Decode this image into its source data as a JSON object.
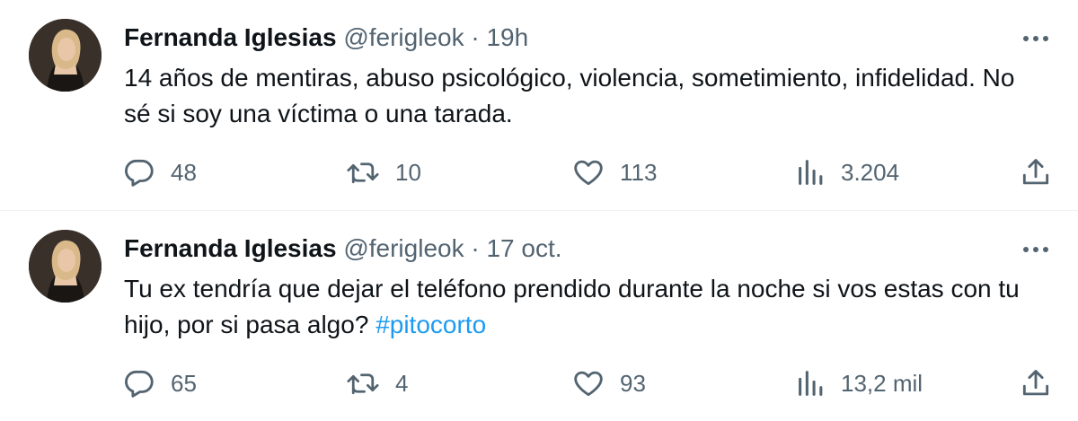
{
  "tweets": [
    {
      "author_name": "Fernanda Iglesias",
      "handle": "@ferigleok",
      "separator": "·",
      "time": "19h",
      "text": "14 años de mentiras, abuso psicológico, violencia, sometimiento, infidelidad. No sé si soy una víctima o una tarada.",
      "hashtag": "",
      "replies": "48",
      "retweets": "10",
      "likes": "113",
      "views": "3.204"
    },
    {
      "author_name": "Fernanda Iglesias",
      "handle": "@ferigleok",
      "separator": "·",
      "time": "17 oct.",
      "text": "Tu ex tendría que dejar el teléfono prendido durante la noche si vos estas con tu hijo, por si pasa algo?",
      "hashtag": "#pitocorto",
      "replies": "65",
      "retweets": "4",
      "likes": "93",
      "views": "13,2 mil"
    }
  ],
  "icons": {
    "reply": "reply-icon",
    "retweet": "retweet-icon",
    "like": "heart-icon",
    "views": "views-icon",
    "share": "share-icon",
    "more": "more-icon"
  },
  "colors": {
    "text_primary": "#0f1419",
    "text_secondary": "#536471",
    "link": "#1d9bf0",
    "divider": "#eff3f4"
  }
}
